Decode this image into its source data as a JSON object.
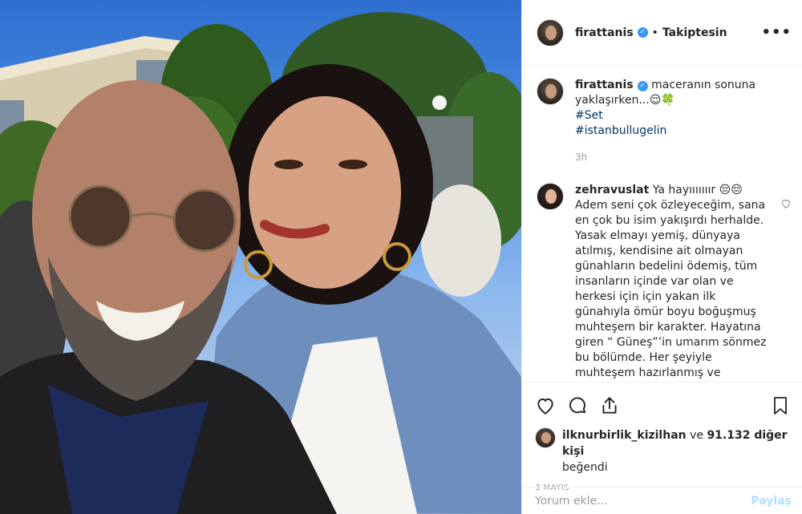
{
  "post": {
    "username": "firattanis",
    "follow_status": "Takiptesin",
    "caption": "maceranın sonuna yaklaşırken...😌🍀",
    "hashtags": [
      "#Set",
      "#istanbullugelin"
    ],
    "caption_time": "3h"
  },
  "comment": {
    "username": "zehravuslat",
    "text": "Ya hayııııııır 😔😔 Adem seni çok özleyeceğim, sana en çok bu isim yakışırdı herhalde. Yasak elmayı yemiş, dünyaya atılmış, kendisine ait olmayan günahların bedelini ödemiş, tüm insanların içinde var olan ve herkesi için için yakan ilk günahıyla ömür boyu boğuşmuş muhteşem bir karakter. Hayatına giren “ Güneş”’in umarım sönmez bu bölümde. Her şeyiyle muhteşem hazırlanmış ve"
  },
  "likes": {
    "user": "ilknurbirlik_kizilhan",
    "rest": " ve ",
    "count": "91.132 diğer kişi",
    "suffix": "beğendi"
  },
  "date": "3 MAYIS",
  "add_comment": {
    "placeholder": "Yorum ekle...",
    "post_label": "Paylaş"
  },
  "colors": {
    "link": "#003569",
    "verified": "#3897f0",
    "post_button": "#b2dffc",
    "muted": "#999999"
  },
  "icons": [
    "heart-icon",
    "comment-icon",
    "share-icon",
    "bookmark-icon",
    "more-icon",
    "verified-icon"
  ]
}
